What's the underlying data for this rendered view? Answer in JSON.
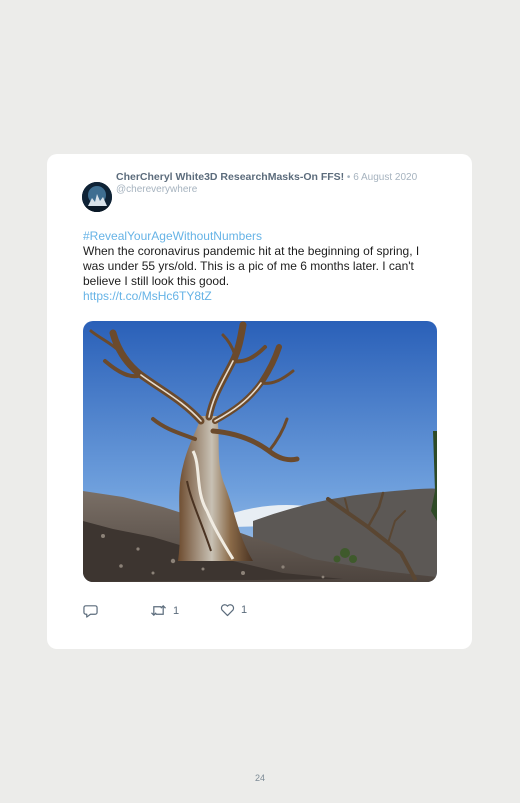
{
  "tweet": {
    "author": "CherCheryl White3D ResearchMasks-On FFS!",
    "separator": " • ",
    "date": "6 August 2020",
    "handle": "@chereverywhere",
    "hashtag": "#RevealYourAgeWithoutNumbers",
    "body": "When the coronavirus pandemic hit at the beginning of spring, I was under 55 yrs/old. This is a pic of me 6 months later. I can't believe I still look this good.",
    "link": "https://t.co/MsHc6TY8tZ",
    "retweets": "1",
    "likes": "1"
  },
  "icons": {
    "reply": "reply-icon",
    "retweet": "retweet-icon",
    "like": "heart-icon"
  },
  "page": {
    "number": "24"
  },
  "colors": {
    "background": "#ececea",
    "card": "#ffffff",
    "link": "#66b3e6",
    "muted": "#a6b3bf",
    "author": "#5c6c7c"
  }
}
